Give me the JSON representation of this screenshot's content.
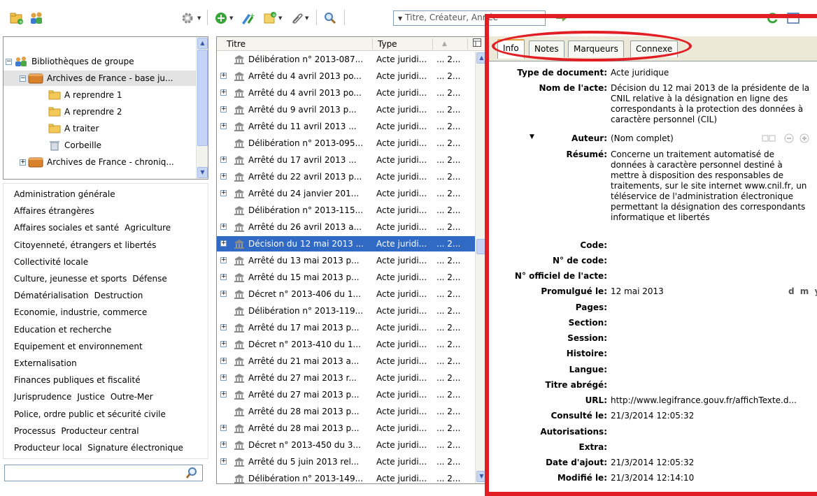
{
  "toolbar": {
    "search_placeholder": "Titre, Créateur, Année"
  },
  "collections": [
    {
      "label": "Bibliothèques de groupe",
      "icon": "group-library-icon"
    },
    {
      "label": "Archives de France - base ju...",
      "icon": "library-icon"
    },
    {
      "label": "A reprendre 1",
      "icon": "folder-icon"
    },
    {
      "label": "A reprendre 2",
      "icon": "folder-icon"
    },
    {
      "label": "A traiter",
      "icon": "folder-icon"
    },
    {
      "label": "Corbeille",
      "icon": "trash-icon"
    },
    {
      "label": "Archives de France - chroniq...",
      "icon": "library-icon"
    }
  ],
  "tags": [
    [
      "Administration générale"
    ],
    [
      "Affaires étrangères"
    ],
    [
      "Affaires sociales et santé",
      "Agriculture"
    ],
    [
      "Citoyenneté, étrangers et libertés"
    ],
    [
      "Collectivité locale"
    ],
    [
      "Culture, jeunesse et sports",
      "Défense"
    ],
    [
      "Dématérialisation",
      "Destruction"
    ],
    [
      "Economie, industrie, commerce"
    ],
    [
      "Education et recherche"
    ],
    [
      "Equipement et environnement"
    ],
    [
      "Externalisation"
    ],
    [
      "Finances publiques et fiscalité"
    ],
    [
      "Jurisprudence",
      "Justice",
      "Outre-Mer"
    ],
    [
      "Police, ordre public et sécurité civile"
    ],
    [
      "Processus",
      "Producteur central"
    ],
    [
      "Producteur local",
      "Signature électronique"
    ]
  ],
  "items": {
    "col_title": "Titre",
    "col_type": "Type",
    "rows": [
      {
        "title": "Délibération n° 2013-087...",
        "type": "Acte juridi...",
        "date": "... 2...",
        "expandable": false
      },
      {
        "title": "Arrêté du 4 avril 2013 po...",
        "type": "Acte juridi...",
        "date": "... 2...",
        "expandable": true
      },
      {
        "title": "Arrêté du 4 avril 2013 po...",
        "type": "Acte juridi...",
        "date": "... 2...",
        "expandable": true
      },
      {
        "title": "Arrêté du 9 avril 2013  p...",
        "type": "Acte juridi...",
        "date": "... 2...",
        "expandable": true
      },
      {
        "title": "Arrêté du 11 avril 2013  ...",
        "type": "Acte juridi...",
        "date": "... 2...",
        "expandable": true
      },
      {
        "title": "Délibération n° 2013-095...",
        "type": "Acte juridi...",
        "date": "... 2...",
        "expandable": false
      },
      {
        "title": "Arrêté du 17 avril 2013  ...",
        "type": "Acte juridi...",
        "date": "... 2...",
        "expandable": true
      },
      {
        "title": "Arrêté du 22 avril 2013 p...",
        "type": "Acte juridi...",
        "date": "... 2...",
        "expandable": true
      },
      {
        "title": "Arrêté du 24 janvier 201...",
        "type": "Acte juridi...",
        "date": "... 2...",
        "expandable": true
      },
      {
        "title": "Délibération n° 2013-115...",
        "type": "Acte juridi...",
        "date": "... 2...",
        "expandable": false
      },
      {
        "title": "Arrêté du 26 avril 2013 a...",
        "type": "Acte juridi...",
        "date": "... 2...",
        "expandable": true
      },
      {
        "title": "Décision du 12 mai 2013 ...",
        "type": "Acte juridi...",
        "date": "... 2...",
        "expandable": true,
        "selected": true
      },
      {
        "title": "Arrêté du 13 mai 2013 p...",
        "type": "Acte juridi...",
        "date": "... 2...",
        "expandable": true
      },
      {
        "title": "Arrêté du 15 mai 2013 p...",
        "type": "Acte juridi...",
        "date": "... 2...",
        "expandable": true
      },
      {
        "title": "Décret n° 2013-406 du 1...",
        "type": "Acte juridi...",
        "date": "... 2...",
        "expandable": true
      },
      {
        "title": "Délibération n° 2013-119...",
        "type": "Acte juridi...",
        "date": "... 2...",
        "expandable": false
      },
      {
        "title": "Arrêté du 17 mai 2013  p...",
        "type": "Acte juridi...",
        "date": "... 2...",
        "expandable": true
      },
      {
        "title": "Décret n° 2013-410 du 1...",
        "type": "Acte juridi...",
        "date": "... 2...",
        "expandable": true
      },
      {
        "title": "Arrêté du 21 mai 2013 a...",
        "type": "Acte juridi...",
        "date": "... 2...",
        "expandable": true
      },
      {
        "title": "Arrêté du 27 mai 2013  r...",
        "type": "Acte juridi...",
        "date": "... 2...",
        "expandable": true
      },
      {
        "title": "Arrêté du 27 mai 2013 p...",
        "type": "Acte juridi...",
        "date": "... 2...",
        "expandable": true
      },
      {
        "title": "Arrêté du 28 mai 2013 p...",
        "type": "Acte juridi...",
        "date": "... 2...",
        "expandable": false
      },
      {
        "title": "Arrêté du 28 mai 2013 p...",
        "type": "Acte juridi...",
        "date": "... 2...",
        "expandable": true
      },
      {
        "title": "Décret n° 2013-450 du 3...",
        "type": "Acte juridi...",
        "date": "... 2...",
        "expandable": true
      },
      {
        "title": "Arrêté du 5 juin 2013 rel...",
        "type": "Acte juridi...",
        "date": "... 2...",
        "expandable": true
      },
      {
        "title": "Délibération n° 2013-149...",
        "type": "Acte juridi...",
        "date": "... 2...",
        "expandable": false
      }
    ]
  },
  "tabs": [
    "Info",
    "Notes",
    "Marqueurs",
    "Connexe"
  ],
  "info": {
    "type_label": "Type de document:",
    "type_value": "Acte juridique",
    "nom_label": "Nom de l'acte:",
    "nom_lines": [
      "Décision du 12 mai 2013 de la présidente de la",
      "CNIL relative à la désignation en ligne des",
      "correspondants à la protection des données à",
      "caractère personnel (CIL)"
    ],
    "auteur_label": "Auteur:",
    "auteur_value": "(Nom complet)",
    "resume_label": "Résumé:",
    "resume_lines": [
      "Concerne un traitement automatisé de",
      "données à caractère personnel destiné à",
      "mettre à disposition des responsables de",
      "traitements, sur le site internet www.cnil.fr, un",
      "téléservice de l'administration électronique",
      "permettant la désignation des correspondants",
      "informatique et libertés"
    ],
    "code_label": "Code:",
    "ncode_label": "N° de code:",
    "nofficiel_label": "N° officiel de l'acte:",
    "promulgue_label": "Promulgué le:",
    "promulgue_value": "12 mai 2013",
    "dmy": "d m y",
    "pages_label": "Pages:",
    "section_label": "Section:",
    "session_label": "Session:",
    "histoire_label": "Histoire:",
    "langue_label": "Langue:",
    "titre_label": "Titre abrégé:",
    "url_label": "URL:",
    "url_value": "http://www.legifrance.gouv.fr/affichTexte.d...",
    "consulte_label": "Consulté le:",
    "consulte_value": "21/3/2014 12:05:32",
    "autorisations_label": "Autorisations:",
    "extra_label": "Extra:",
    "ajout_label": "Date d'ajout:",
    "ajout_value": "21/3/2014 12:05:32",
    "modifie_label": "Modifié le:",
    "modifie_value": "21/3/2014 12:14:10"
  }
}
